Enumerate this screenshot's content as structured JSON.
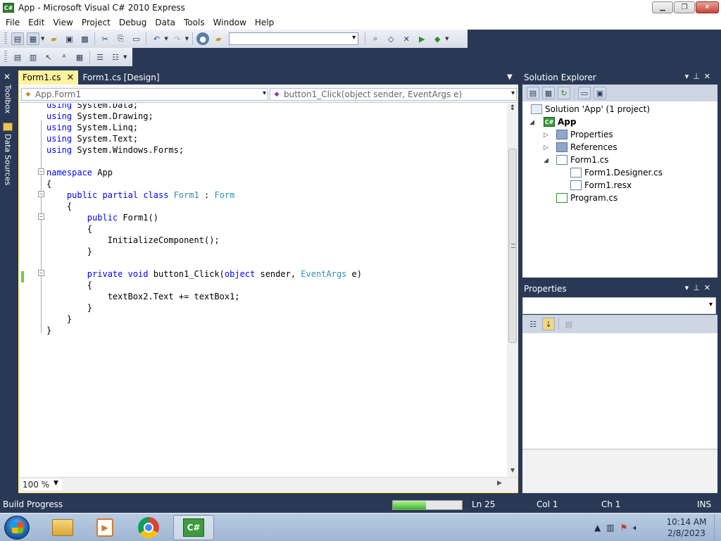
{
  "window": {
    "title": "App - Microsoft Visual C# 2010 Express",
    "icon": "C#"
  },
  "menu": [
    "File",
    "Edit",
    "View",
    "Project",
    "Debug",
    "Data",
    "Tools",
    "Window",
    "Help"
  ],
  "toolbar": {
    "configuration_value": ""
  },
  "left_strip": {
    "toolbox": "Toolbox",
    "data_sources": "Data Sources"
  },
  "tabs": [
    {
      "label": "Form1.cs",
      "active": true
    },
    {
      "label": "Form1.cs [Design]",
      "active": false
    }
  ],
  "editor": {
    "type_combo": "App.Form1",
    "member_combo": "button1_Click(object sender, EventArgs e)",
    "zoom": "100 %"
  },
  "code": {
    "l1": {
      "kw": "using",
      "rest": " System.Data;"
    },
    "l2": {
      "kw": "using",
      "rest": " System.Drawing;"
    },
    "l3": {
      "kw": "using",
      "rest": " System.Linq;"
    },
    "l4": {
      "kw": "using",
      "rest": " System.Text;"
    },
    "l5": {
      "kw": "using",
      "rest": " System.Windows.Forms;"
    },
    "l6": {
      "kw": "namespace",
      "rest": " App"
    },
    "l7": "{",
    "l8": {
      "kw1": "public",
      "kw2": "partial",
      "kw3": "class",
      "type": "Form1",
      "colon": " : ",
      "base": "Form"
    },
    "l9": "    {",
    "l10": {
      "kw": "public",
      "rest": " Form1()"
    },
    "l11": "        {",
    "l12": "            InitializeComponent();",
    "l13": "        }",
    "l14": {
      "kw1": "private",
      "kw2": "void",
      "name": " button1_Click(",
      "kw3": "object",
      "mid": " sender, ",
      "type": "EventArgs",
      "end": " e)"
    },
    "l15": "        {",
    "l16": "            textBox2.Text += textBox1;",
    "l17": "        }",
    "l18": "    }",
    "l19": "}"
  },
  "solution_explorer": {
    "title": "Solution Explorer",
    "items": {
      "solution": "Solution 'App' (1 project)",
      "project": "App",
      "properties": "Properties",
      "references": "References",
      "form1": "Form1.cs",
      "designer": "Form1.Designer.cs",
      "resx": "Form1.resx",
      "program": "Program.cs"
    }
  },
  "properties_panel": {
    "title": "Properties"
  },
  "status": {
    "build": "Build Progress",
    "progress": 0.48,
    "ln": "Ln 25",
    "col": "Col 1",
    "ch": "Ch 1",
    "mode": "INS"
  },
  "taskbar": {
    "active_app": "C#",
    "time": "10:14 AM",
    "date": "2/8/2023"
  },
  "colors": {
    "chrome": "#293955",
    "active_tab": "#fff29d",
    "keyword": "#0000ff",
    "type": "#2b91af"
  }
}
